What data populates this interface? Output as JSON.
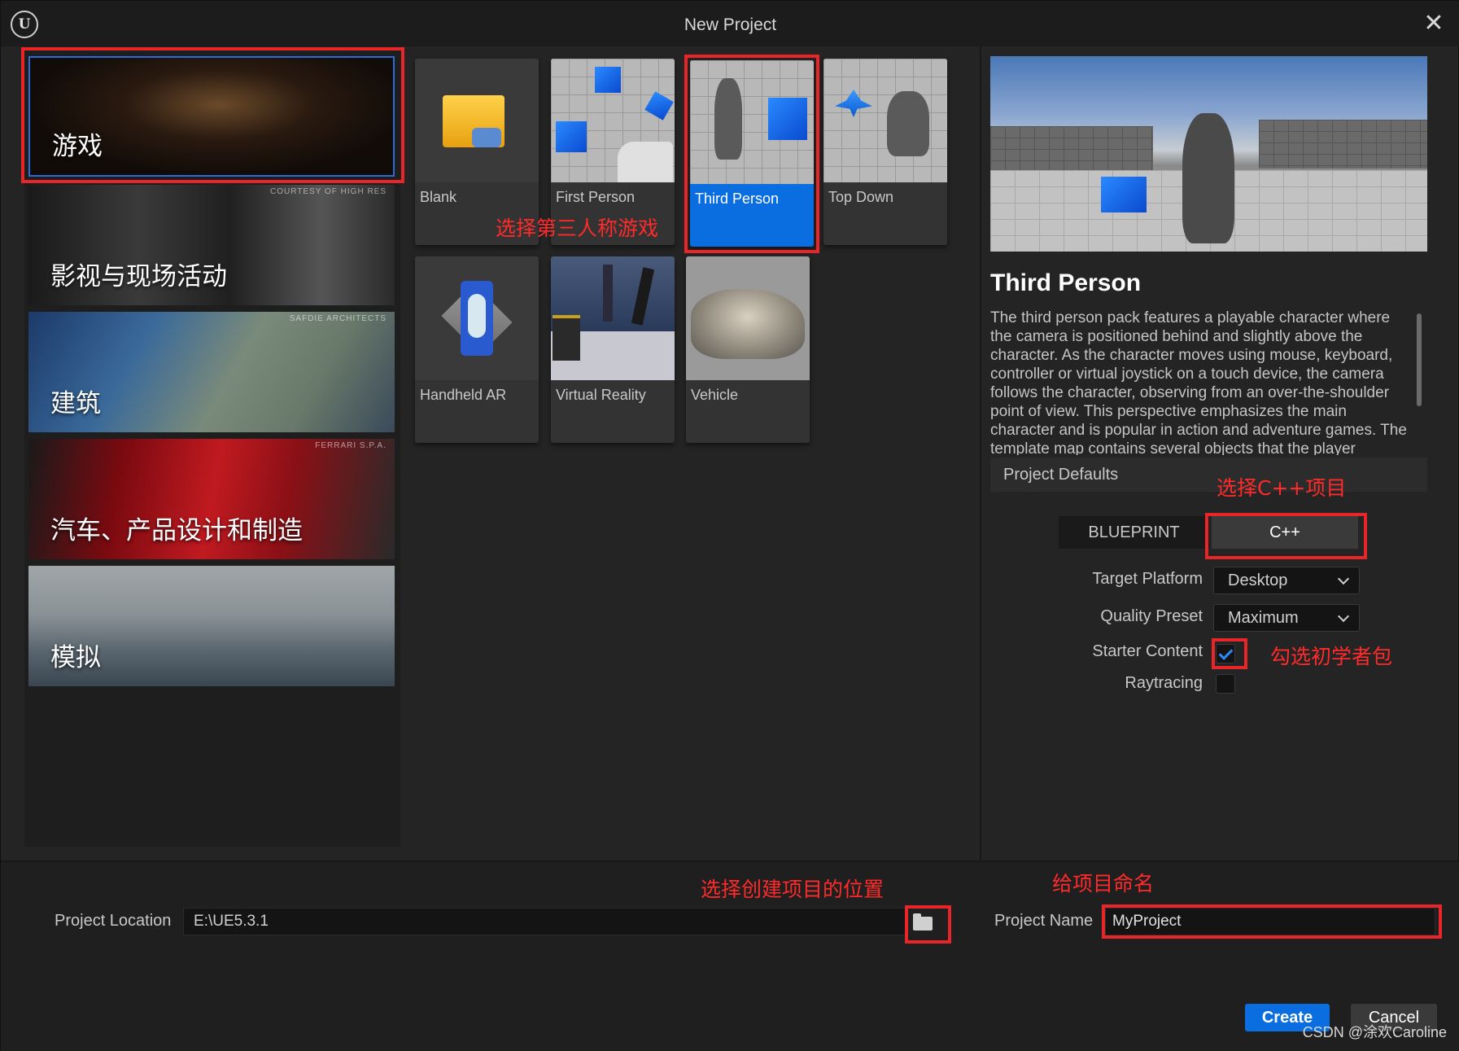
{
  "window": {
    "title": "New Project",
    "logo_text": "U",
    "close_glyph": "✕"
  },
  "categories": [
    {
      "label": "游戏",
      "credit": "",
      "selected": true
    },
    {
      "label": "影视与现场活动",
      "credit": "COURTESY OF HIGH RES"
    },
    {
      "label": "建筑",
      "credit": "SAFDIE ARCHITECTS"
    },
    {
      "label": "汽车、产品设计和制造",
      "credit": "FERRARI S.P.A."
    },
    {
      "label": "模拟",
      "credit": ""
    }
  ],
  "templates": [
    {
      "label": "Blank"
    },
    {
      "label": "First Person"
    },
    {
      "label": "Third Person",
      "selected": true
    },
    {
      "label": "Top Down"
    },
    {
      "label": "Handheld AR"
    },
    {
      "label": "Virtual Reality"
    },
    {
      "label": "Vehicle"
    }
  ],
  "annotations": {
    "select_third_person": "选择第三人称游戏",
    "select_cpp": "选择C++项目",
    "check_starter": "勾选初学者包",
    "choose_location": "选择创建项目的位置",
    "name_project": "给项目命名"
  },
  "details": {
    "title": "Third Person",
    "description": "The third person pack features a playable character where the camera is positioned behind and slightly above the character. As the character moves using mouse, keyboard, controller or virtual joystick on a touch device, the camera follows the character, observing from an over-the-shoulder point of view. This perspective emphasizes the main character and is popular in action and adventure games. The template map contains several objects that the player",
    "defaults_header": "Project Defaults",
    "blueprint_label": "BLUEPRINT",
    "cpp_label": "C++",
    "target_platform_label": "Target Platform",
    "target_platform_value": "Desktop",
    "quality_preset_label": "Quality Preset",
    "quality_preset_value": "Maximum",
    "starter_content_label": "Starter Content",
    "starter_content_checked": true,
    "raytracing_label": "Raytracing",
    "raytracing_checked": false
  },
  "bottom": {
    "location_label": "Project Location",
    "location_value": "E:\\UE5.3.1",
    "name_label": "Project Name",
    "name_value": "MyProject",
    "create_label": "Create",
    "cancel_label": "Cancel"
  },
  "watermark": "CSDN @涂欢Caroline",
  "colors": {
    "accent": "#0a6ee0",
    "annotation_red": "#e8262a",
    "background": "#242424"
  }
}
